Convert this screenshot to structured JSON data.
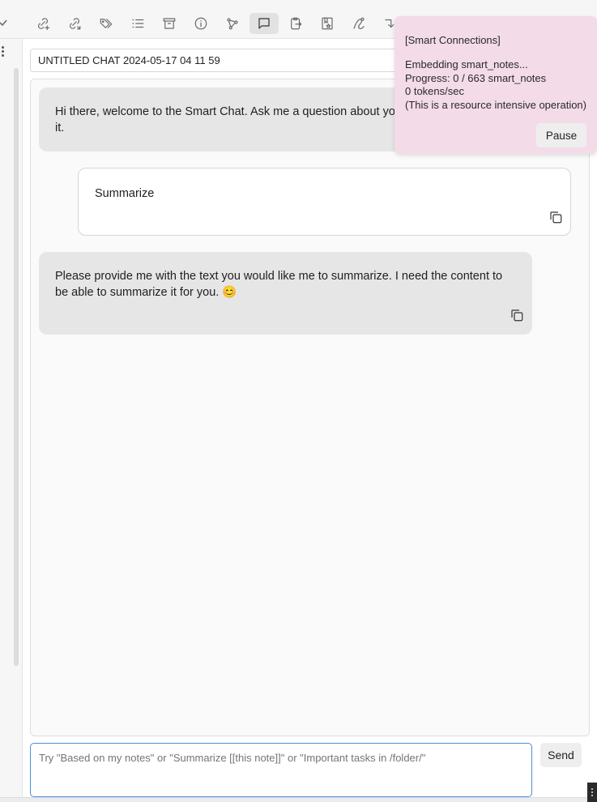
{
  "toolbar": {
    "icons": [
      "check-icon",
      "link-add-icon",
      "link-out-icon",
      "tags-icon",
      "list-icon",
      "archive-icon",
      "info-icon",
      "graph-icon",
      "chat-icon",
      "clipboard-export-icon",
      "bookmark-star-icon",
      "hand-drawn-icon",
      "arrow-return-icon"
    ],
    "active_icon": "chat-icon"
  },
  "chat": {
    "name": "UNTITLED CHAT 2024-05-17 04 11 59",
    "messages": [
      {
        "role": "assistant",
        "text": "Hi there, welcome to the Smart Chat. Ask me a question about your notes and I'll try to answer it."
      },
      {
        "role": "user",
        "text": "Summarize"
      },
      {
        "role": "assistant",
        "text": "Please provide me with the text you would like me to summarize. I need the content to be able to summarize it for you. 😊"
      }
    ]
  },
  "input": {
    "placeholder": "Try \"Based on my notes\" or \"Summarize [[this note]]\" or \"Important tasks in /folder/\"",
    "send_label": "Send"
  },
  "notice": {
    "title": "[Smart Connections]",
    "line1": "Embedding smart_notes...",
    "line2": "Progress: 0 / 663 smart_notes",
    "line3": "0 tokens/sec",
    "line4": "(This is a resource intensive operation)",
    "pause_label": "Pause"
  },
  "colors": {
    "notice_bg": "#f3dbe8",
    "bot_bubble": "#e6e6e6",
    "input_focus": "#4a90d9"
  }
}
